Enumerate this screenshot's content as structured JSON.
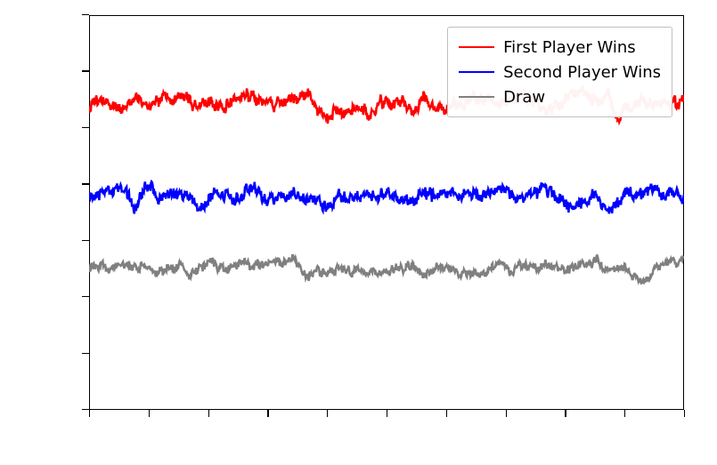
{
  "chart_data": {
    "type": "line",
    "title": "",
    "xlabel": "",
    "ylabel": "",
    "xlim": [
      0,
      1000
    ],
    "ylim": [
      -0.1,
      0.6
    ],
    "legend_position": "upper right",
    "series": [
      {
        "name": "First Player Wins",
        "color": "#ff0000",
        "mean": 0.44,
        "noise_amp": 0.025
      },
      {
        "name": "Second Player Wins",
        "color": "#0000ff",
        "mean": 0.28,
        "noise_amp": 0.025
      },
      {
        "name": "Draw",
        "color": "#808080",
        "mean": 0.15,
        "noise_amp": 0.018
      }
    ],
    "x_ticks_at": [
      0,
      100,
      200,
      300,
      400,
      500,
      600,
      700,
      800,
      900,
      1000
    ],
    "y_ticks_at": [
      -0.1,
      0.0,
      0.1,
      0.2,
      0.3,
      0.4,
      0.5,
      0.6
    ],
    "n_points": 1001
  },
  "legend": {
    "items": [
      {
        "label": "First Player Wins"
      },
      {
        "label": "Second Player Wins"
      },
      {
        "label": "Draw"
      }
    ]
  }
}
